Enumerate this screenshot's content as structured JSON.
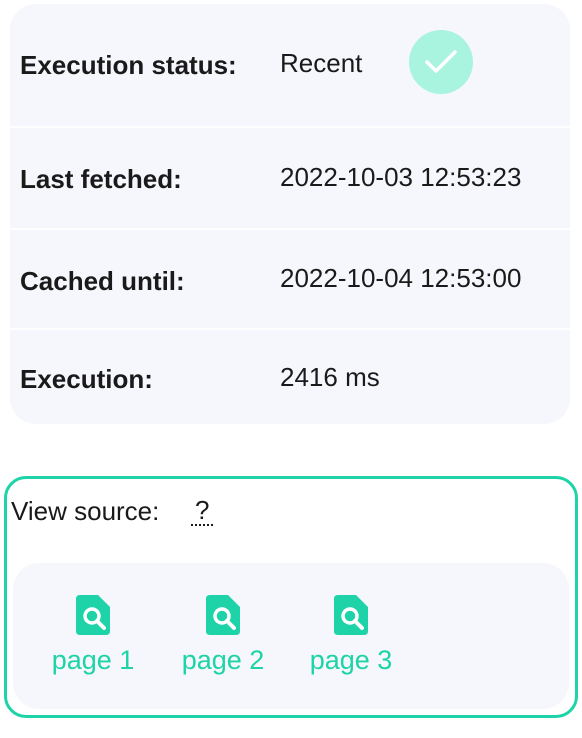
{
  "status": {
    "rows": [
      {
        "label": "Execution status:",
        "value": "Recent"
      },
      {
        "label": "Last fetched:",
        "value": "2022-10-03 12:53:23"
      },
      {
        "label": "Cached until:",
        "value": "2022-10-04 12:53:00"
      },
      {
        "label": "Execution:",
        "value": "2416 ms"
      }
    ],
    "badge_icon": "check-icon",
    "badge_color": "#a9f4df"
  },
  "source": {
    "header": "View source:",
    "help_label": "?",
    "pages": [
      {
        "label": "page 1",
        "icon": "file-search-icon"
      },
      {
        "label": "page 2",
        "icon": "file-search-icon"
      },
      {
        "label": "page 3",
        "icon": "file-search-icon"
      }
    ],
    "accent_color": "#1dd3a7"
  }
}
